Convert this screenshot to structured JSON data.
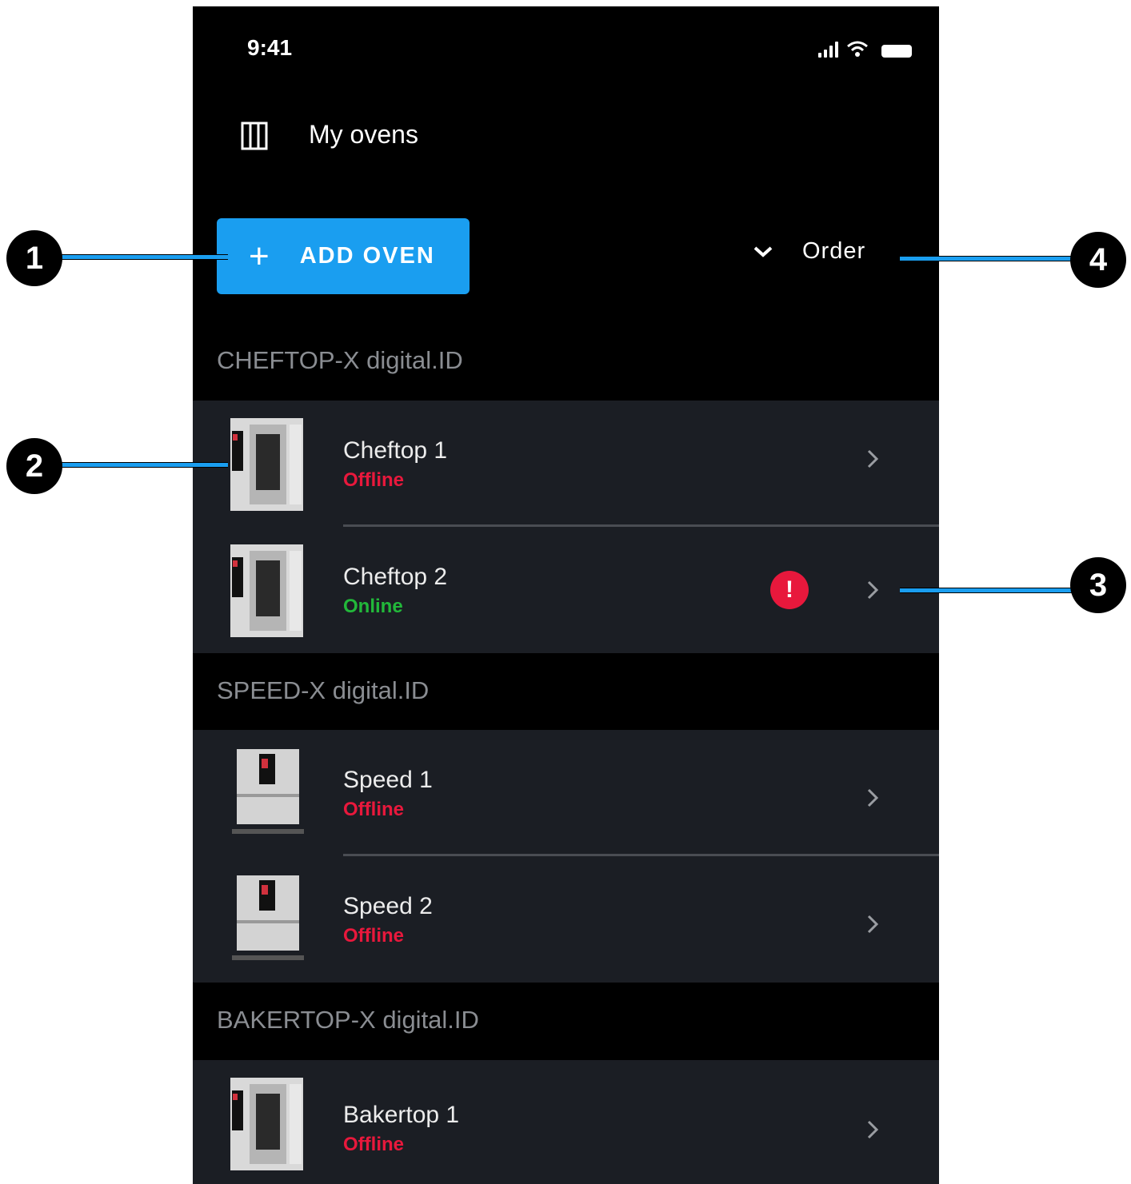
{
  "status_bar": {
    "time": "9:41"
  },
  "header": {
    "title": "My ovens",
    "menu_icon": "panel-icon"
  },
  "toolbar": {
    "add_icon": "+",
    "add_label": "ADD OVEN",
    "order_label": "Order"
  },
  "sections": [
    {
      "title": "CHEFTOP-X digital.ID",
      "ovens": [
        {
          "name": "Cheftop 1",
          "status": "Offline",
          "alert": false
        },
        {
          "name": "Cheftop 2",
          "status": "Online",
          "alert": true
        }
      ]
    },
    {
      "title": "SPEED-X digital.ID",
      "ovens": [
        {
          "name": "Speed 1",
          "status": "Offline",
          "alert": false
        },
        {
          "name": "Speed 2",
          "status": "Offline",
          "alert": false
        }
      ]
    },
    {
      "title": "BAKERTOP-X digital.ID",
      "ovens": [
        {
          "name": "Bakertop 1",
          "status": "Offline",
          "alert": false
        }
      ]
    }
  ],
  "alert_symbol": "!",
  "callouts": [
    "1",
    "2",
    "3",
    "4"
  ],
  "colors": {
    "accent": "#1a9ef0",
    "offline": "#e8183c",
    "online": "#22b83a",
    "row_bg": "#1b1e24"
  }
}
